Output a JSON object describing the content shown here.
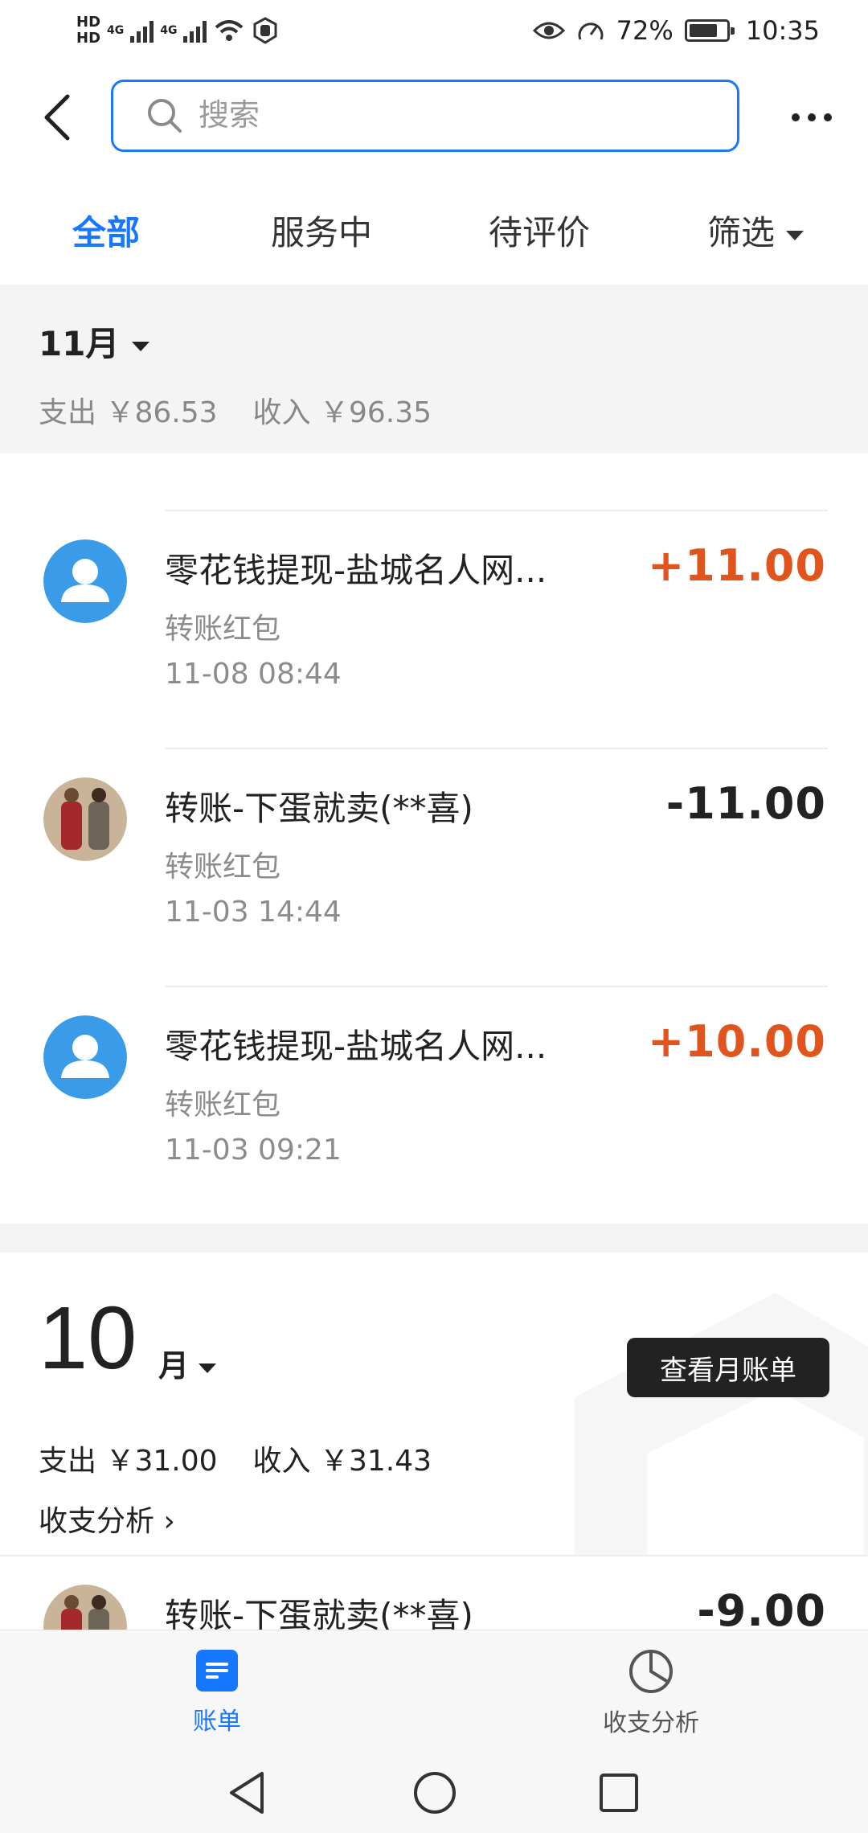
{
  "status_bar": {
    "hd1": "HD",
    "hd2": "HD",
    "sim1": "4G",
    "sim2": "4G",
    "battery_pct": "72%",
    "time": "10:35"
  },
  "header": {
    "search_placeholder": "搜索"
  },
  "tabs": [
    {
      "label": "全部",
      "active": true
    },
    {
      "label": "服务中",
      "active": false
    },
    {
      "label": "待评价",
      "active": false
    },
    {
      "label": "筛选",
      "active": false
    }
  ],
  "current_month": {
    "label": "11月",
    "expense": "支出 ￥86.53",
    "income": "收入 ￥96.35"
  },
  "entries": [
    {
      "title": "零花钱提现-盐城名人网...",
      "type": "转账红包",
      "time": "11-08  08:44",
      "amount": "+11.00",
      "avatar": "default-avatar"
    },
    {
      "title": "转账-下蛋就卖(**喜)",
      "type": "转账红包",
      "time": "11-03  14:44",
      "amount": "-11.00",
      "avatar": "photo-avatar"
    },
    {
      "title": "零花钱提现-盐城名人网...",
      "type": "转账红包",
      "time": "11-03  09:21",
      "amount": "+10.00",
      "avatar": "default-avatar"
    }
  ],
  "october": {
    "month_number": "10",
    "month_unit": "月",
    "view_bill_button": "查看月账单",
    "expense": "支出 ￥31.00",
    "income": "收入 ￥31.43",
    "analysis_link": "收支分析 ›"
  },
  "partial_entry": {
    "title": "转账-下蛋就卖(**喜)",
    "amount": "-9.00"
  },
  "bottom_tabs": [
    {
      "label": "账单",
      "icon": "bill-icon",
      "active": true
    },
    {
      "label": "收支分析",
      "icon": "pie-chart-icon",
      "active": false
    }
  ],
  "colors": {
    "accent": "#1677ff",
    "income": "#e0541e",
    "expense": "#222222"
  }
}
